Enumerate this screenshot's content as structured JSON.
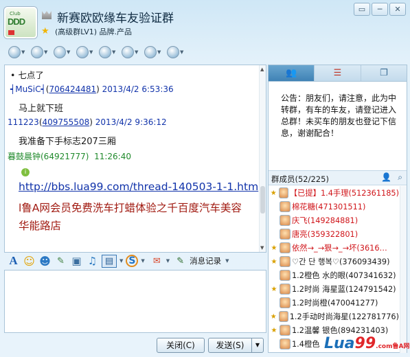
{
  "window": {
    "title": "新赛欧欧缘车友验证群",
    "subtitle": "(高级群LV1) 品牌.产品",
    "controls": [
      "▭",
      "─",
      "✕"
    ]
  },
  "logo": {
    "text": "DDD",
    "small": "Club"
  },
  "toolbar": {
    "icons": [
      "home-icon",
      "share-icon",
      "grid-icon",
      "microphone-icon",
      "document-icon",
      "camera-icon",
      "app-icon",
      "settings-icon"
    ]
  },
  "chat": {
    "messages": [
      {
        "kind": "text",
        "text": "• 七点了"
      },
      {
        "kind": "header",
        "nick": "┥MuSiC┥",
        "id": "706424481",
        "time": "2013/4/2 6:53:36"
      },
      {
        "kind": "text",
        "text": "马上就下班"
      },
      {
        "kind": "header",
        "nick": "111223",
        "id": "409755508",
        "time": "2013/4/2 9:36:12"
      },
      {
        "kind": "text",
        "text": "我准备下手标志207三厢"
      },
      {
        "kind": "header_green",
        "nick": "暮鼓晨钟(64921777)",
        "time": "11:26:40"
      },
      {
        "kind": "link",
        "text": "http://bbs.lua99.com/thread-140503-1-1.htm"
      },
      {
        "kind": "red",
        "text": "l鲁A网会员免费洗车打蜡体验之千百度汽车美容"
      },
      {
        "kind": "red",
        "text": "华能路店"
      }
    ]
  },
  "input_toolbar": {
    "icons": [
      "font-icon",
      "emoji-icon",
      "magic-emoji-icon",
      "screenshot-icon",
      "image-icon",
      "music-icon",
      "screen-capture-icon",
      "sougou-icon",
      "shake-icon",
      "history-icon"
    ],
    "glyphs": [
      "A",
      "☺",
      "☻",
      "✎",
      "▣",
      "♫",
      "▤",
      "S",
      "✉",
      "✎"
    ],
    "history_label": "消息记录"
  },
  "buttons": {
    "close": "关闭(C)",
    "send": "发送(S)"
  },
  "right_panel": {
    "notice": "公告：朋友们，请注意，此为中转群，有车的车友，请登记进入总群！未买车的朋友也登记下信息，谢谢配合！",
    "members_label": "群成员(52/225)",
    "members": [
      {
        "badge": "★",
        "name": "【已提】1.4手理(512361185)",
        "color": "#d0151a"
      },
      {
        "badge": "",
        "name": "棉花糖(471301511)",
        "color": "#d0151a"
      },
      {
        "badge": "",
        "name": "庆飞(149284881)",
        "color": "#d0151a"
      },
      {
        "badge": "",
        "name": "唐亮(359322801)",
        "color": "#d0151a"
      },
      {
        "badge": "★",
        "name": "依然→_→狠→_→坏(3616…",
        "color": "#d0151a"
      },
      {
        "badge": "★",
        "name": "♡간 단 행복♡(376093439)",
        "color": "#222222"
      },
      {
        "badge": "",
        "name": "1.2橙色 水的眼(407341632)",
        "color": "#222222"
      },
      {
        "badge": "★",
        "name": "1.2时尚 海星蓝(124791542)",
        "color": "#222222"
      },
      {
        "badge": "",
        "name": "1.2时尚橙(470041277)",
        "color": "#222222"
      },
      {
        "badge": "★",
        "name": "1.2手动时尚海星(122781776)",
        "color": "#222222"
      },
      {
        "badge": "★",
        "name": "1.2温馨 银色(894231403)",
        "color": "#222222"
      },
      {
        "badge": "",
        "name": "1.4橙色",
        "color": "#222222"
      }
    ]
  },
  "watermark": {
    "main": "Lua",
    "accent": "99",
    "tail": ".com",
    "small": "鲁A网"
  }
}
